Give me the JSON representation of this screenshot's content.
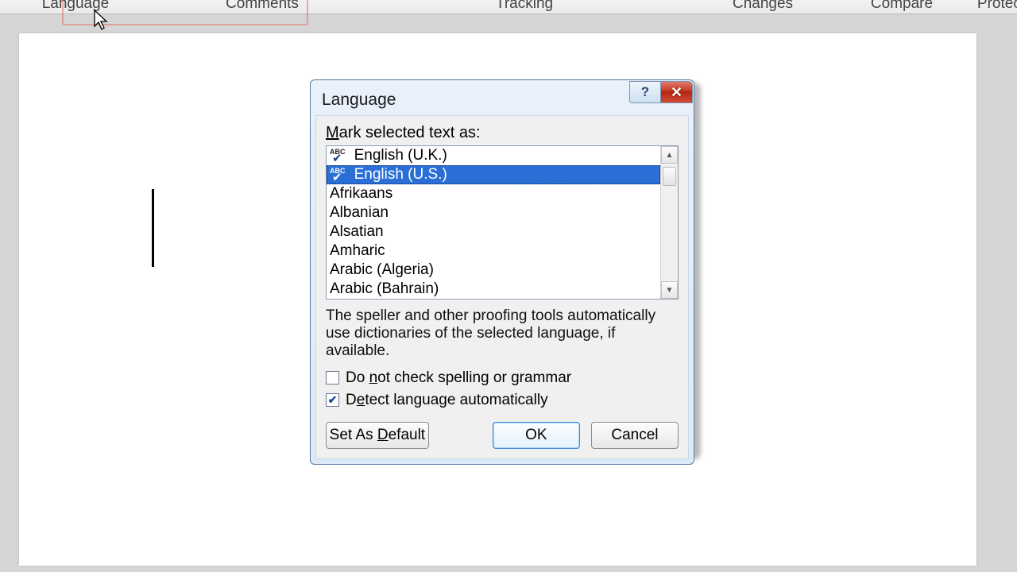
{
  "ribbon": {
    "groups": {
      "language": "Language",
      "comments": "Comments",
      "tracking": "Tracking",
      "changes": "Changes",
      "compare": "Compare",
      "protect": "Protect"
    }
  },
  "dialog": {
    "title": "Language",
    "mark_label_pre": "M",
    "mark_label_post": "ark selected text as:",
    "languages": [
      {
        "label": "English (U.K.)",
        "spellcheck": true
      },
      {
        "label": "English (U.S.)",
        "spellcheck": true,
        "selected": true
      },
      {
        "label": "Afrikaans"
      },
      {
        "label": "Albanian"
      },
      {
        "label": "Alsatian"
      },
      {
        "label": "Amharic"
      },
      {
        "label": "Arabic (Algeria)"
      },
      {
        "label": "Arabic (Bahrain)"
      }
    ],
    "info_text": "The speller and other proofing tools automatically use dictionaries of the selected language, if available.",
    "cb_no_check": {
      "pre": "Do ",
      "ul": "n",
      "post": "ot check spelling or grammar",
      "checked": false
    },
    "cb_detect": {
      "pre": "D",
      "ul": "e",
      "post": "tect language automatically",
      "checked": true
    },
    "buttons": {
      "set_default_pre": "Set As ",
      "set_default_ul": "D",
      "set_default_post": "efault",
      "ok": "OK",
      "cancel": "Cancel"
    }
  }
}
